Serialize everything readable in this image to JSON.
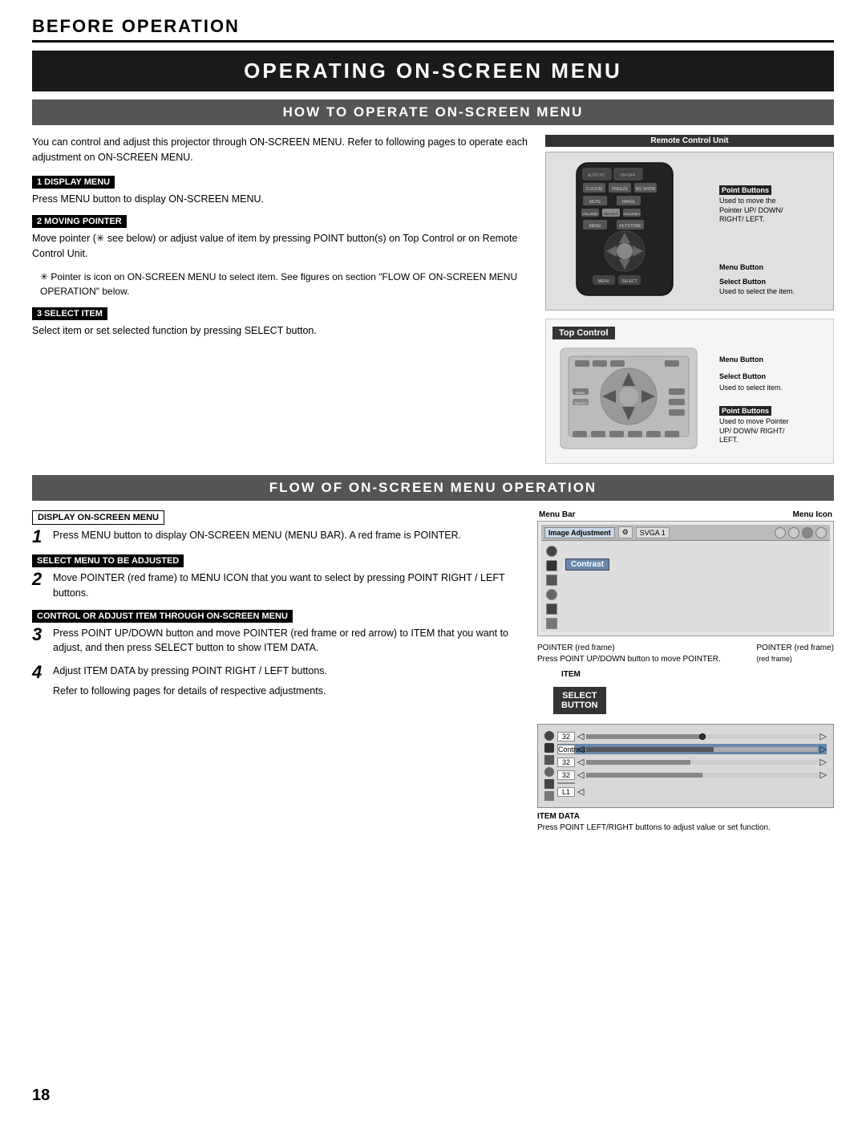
{
  "header": {
    "title": "Before Operation"
  },
  "main_title": "Operating On-Screen Menu",
  "section1": {
    "title": "How to Operate On-Screen Menu",
    "intro": "You can control and adjust this projector through ON-SCREEN MENU.  Refer to following pages to operate each adjustment on ON-SCREEN MENU.",
    "sub1_label": "1  Display Menu",
    "sub1_text": "Press MENU button to display ON-SCREEN MENU.",
    "sub2_label": "2  Moving Pointer",
    "sub2_text": "Move pointer (✳ see below) or adjust value of item by pressing POINT button(s) on Top Control or on Remote Control Unit.",
    "note": "✳ Pointer is icon on ON-SCREEN MENU to select item.  See figures on section \"FLOW OF ON-SCREEN MENU OPERATION\" below.",
    "sub3_label": "3  Select Item",
    "sub3_text": "Select item or set selected function by pressing SELECT button.",
    "remote_title": "Remote Control Unit",
    "top_control_title": "Top Control",
    "point_buttons_label1": "Point Buttons",
    "point_buttons_desc1": "Used to move the Pointer UP/ DOWN/ RIGHT/ LEFT.",
    "menu_button_label": "Menu Button",
    "select_button_label": "Select Button",
    "select_button_desc": "Used to select the item.",
    "point_buttons_label2": "Point Buttons",
    "point_buttons_desc2": "Used to move Pointer UP/ DOWN/ RIGHT/ LEFT.",
    "menu_button_label2": "Menu Button",
    "select_button_label2": "Select Button",
    "select_button_desc2": "Used to select item."
  },
  "section2": {
    "title": "Flow of On-Screen Menu Operation",
    "step1_label": "Display ON-SCREEN MENU",
    "step1_num": "1",
    "step1_text": "Press MENU button to display ON-SCREEN MENU (MENU BAR).  A red frame is POINTER.",
    "step2_label": "Select Menu to be adjusted",
    "step2_num": "2",
    "step2_text": "Move POINTER (red frame) to MENU ICON that you want to select by pressing POINT RIGHT / LEFT buttons.",
    "step3_label": "Control or adjust item through ON-SCREEN MENU",
    "step3_num": "3",
    "step3_text": "Press POINT UP/DOWN button and move POINTER (red frame or red arrow) to ITEM that you want to adjust, and then press SELECT button to show ITEM DATA.",
    "step4_num": "4",
    "step4_text1": "Adjust ITEM DATA by pressing POINT RIGHT / LEFT buttons.",
    "step4_text2": "Refer to following pages for details of respective adjustments.",
    "menu_bar_label": "Menu Bar",
    "menu_icon_label": "Menu Icon",
    "pointer_label1": "POINTER (red frame)",
    "press_point_label": "Press POINT UP/DOWN button to move POINTER.",
    "pointer_label2": "POINTER (red frame)",
    "item_label": "ITEM",
    "select_button_label": "Select Button",
    "item_data_label": "ITEM DATA",
    "item_data_desc": "Press POINT LEFT/RIGHT buttons to adjust value or set function.",
    "menu_bar_items": [
      "Image Adjustment",
      "SVGA 1"
    ],
    "contrast_label": "Contrast",
    "data_values": [
      "32",
      "32",
      "32",
      "L1"
    ]
  },
  "page_number": "18"
}
